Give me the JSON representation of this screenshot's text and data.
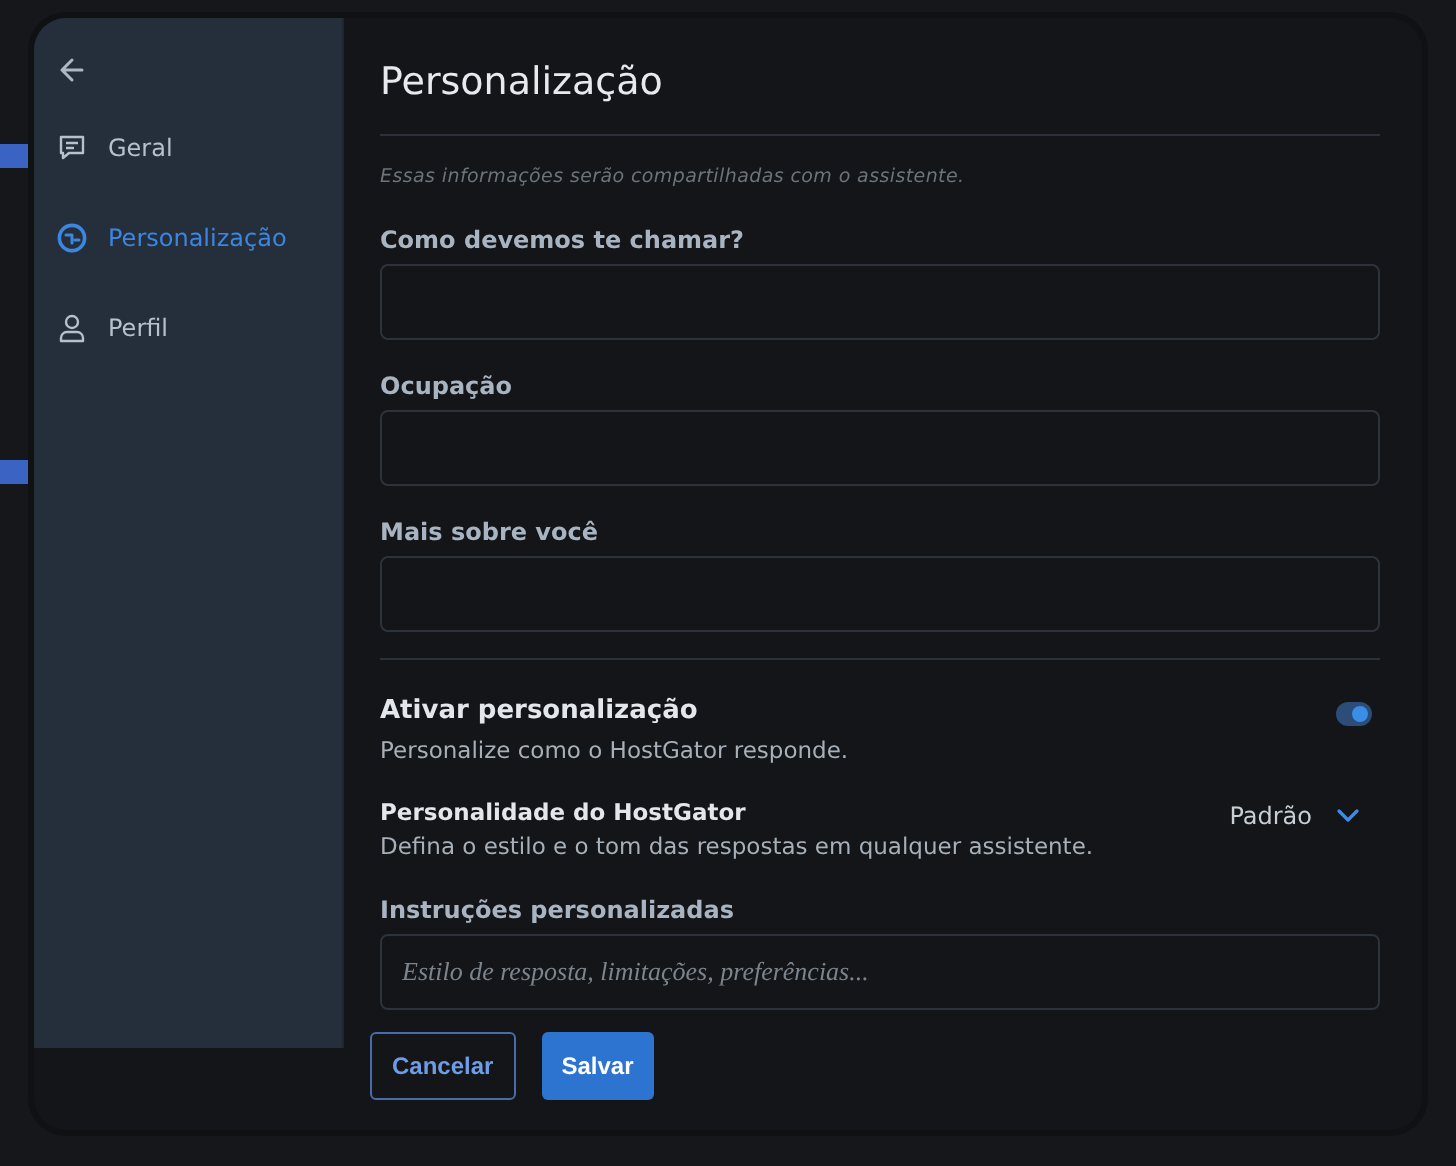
{
  "sidebar": {
    "items": [
      {
        "label": "Geral",
        "kind": "chat",
        "selected": false
      },
      {
        "label": "Personalização",
        "kind": "face",
        "selected": true
      },
      {
        "label": "Perfil",
        "kind": "user",
        "selected": false
      }
    ]
  },
  "title": "Personalização",
  "note": "Essas informações serão compartilhadas com o assistente.",
  "fields": [
    {
      "label": "Como devemos te chamar?"
    },
    {
      "label": "Ocupação"
    },
    {
      "label": "Mais sobre você"
    }
  ],
  "personalization": {
    "title": "Ativar personalização",
    "description": "Personalize como o HostGator responde.",
    "on": true
  },
  "personality": {
    "title": "Personalidade do HostGator",
    "description": "Defina o estilo e o tom das respostas em qualquer assistente.",
    "value": "Padrão"
  },
  "instructions": {
    "label": "Instruções personalizadas",
    "placeholder": "Estilo de resposta, limitações, preferências..."
  },
  "buttons": [
    {
      "label": "Cancelar",
      "kind": "secondary"
    },
    {
      "label": "Salvar",
      "kind": "primary"
    }
  ]
}
